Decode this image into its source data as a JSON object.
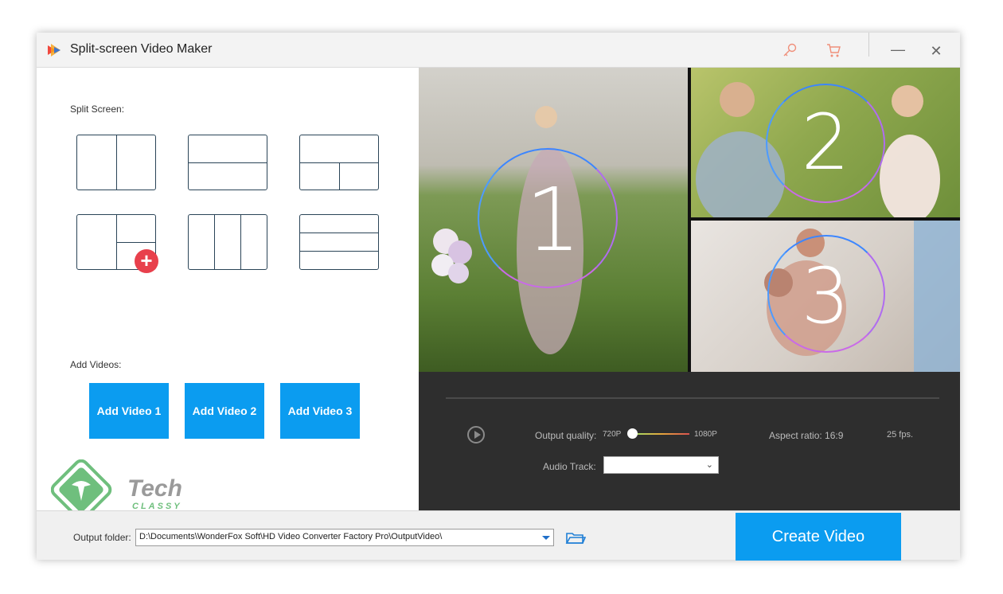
{
  "window": {
    "title": "Split-screen Video Maker",
    "icons": [
      "app-logo-icon",
      "key-icon",
      "cart-icon",
      "minimize-icon",
      "close-icon"
    ],
    "minimize_glyph": "—",
    "close_glyph": "✕"
  },
  "left_panel": {
    "split_screen_label": "Split Screen:",
    "add_videos_label": "Add Videos:",
    "add_buttons": [
      "Add Video 1",
      "Add Video 2",
      "Add Video 3"
    ],
    "plus_glyph": "+"
  },
  "watermark": {
    "word1": "Tech",
    "word2": "CLASSY"
  },
  "preview": {
    "cells": [
      "1",
      "2",
      "3"
    ]
  },
  "controls": {
    "output_quality_label": "Output quality:",
    "quality_min": "720P",
    "quality_max": "1080P",
    "quality_value": 0,
    "aspect_ratio": "Aspect ratio: 16:9",
    "fps": "25 fps.",
    "audio_track_label": "Audio Track:",
    "audio_track_value": "",
    "select_chevron": "⌄"
  },
  "bottom": {
    "output_folder_label": "Output folder:",
    "output_folder_value": "D:\\Documents\\WonderFox Soft\\HD Video Converter Factory Pro\\OutputVideo\\",
    "create_label": "Create Video"
  },
  "colors": {
    "accent": "#0b9cf0",
    "plus_badge": "#e8404c",
    "dark_panel": "#2e2e2e",
    "tile_border": "#2a4457"
  }
}
